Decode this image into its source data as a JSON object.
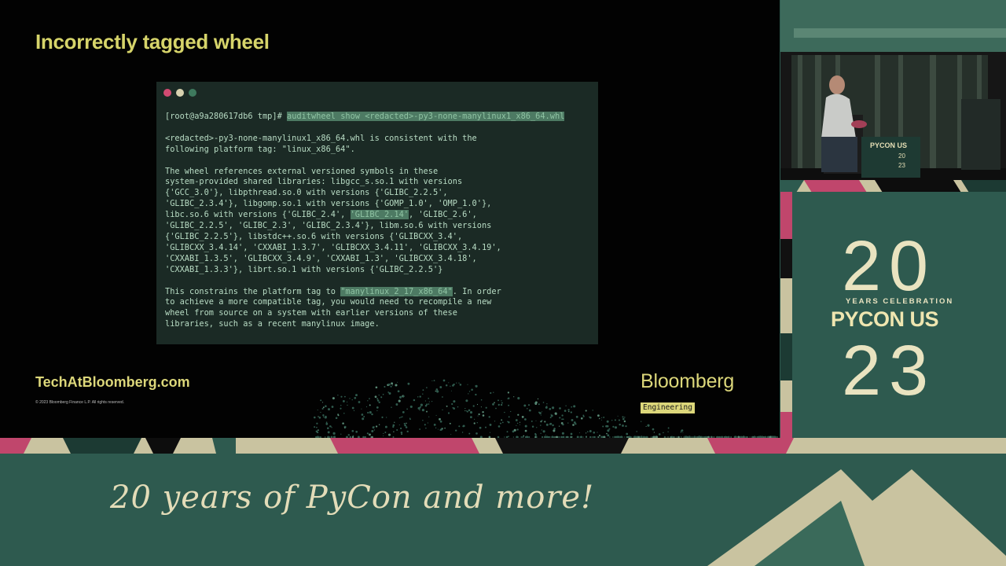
{
  "slide": {
    "title": "Incorrectly tagged wheel",
    "terminal": {
      "prompt": "[root@a9a280617db6 tmp]#",
      "command": "auditwheel show <redacted>-py3-none-manylinux1_x86_64.whl",
      "p1_a": "<redacted>-py3-none-manylinux1_x86_64.whl is consistent with the",
      "p1_b": "following platform tag: \"linux_x86_64\".",
      "p2_1": "The wheel references external versioned symbols in these",
      "p2_2": "system-provided shared libraries: libgcc_s.so.1 with versions",
      "p2_3": "{'GCC_3.0'}, libpthread.so.0 with versions {'GLIBC_2.2.5',",
      "p2_4": "'GLIBC_2.3.4'}, libgomp.so.1 with versions {'GOMP_1.0', 'OMP_1.0'},",
      "p2_5a": "libc.so.6 with versions {'GLIBC_2.4', ",
      "p2_5hl": "'GLIBC_2.14'",
      "p2_5b": ", 'GLIBC_2.6',",
      "p2_6": "'GLIBC_2.2.5', 'GLIBC_2.3', 'GLIBC_2.3.4'}, libm.so.6 with versions",
      "p2_7": "{'GLIBC_2.2.5'}, libstdc++.so.6 with versions {'GLIBCXX_3.4',",
      "p2_8": "'GLIBCXX_3.4.14', 'CXXABI_1.3.7', 'GLIBCXX_3.4.11', 'GLIBCXX_3.4.19',",
      "p2_9": "'CXXABI_1.3.5', 'GLIBCXX_3.4.9', 'CXXABI_1.3', 'GLIBCXX_3.4.18',",
      "p2_10": "'CXXABI_1.3.3'}, librt.so.1 with versions {'GLIBC_2.2.5'}",
      "p3_1a": "This constrains the platform tag to ",
      "p3_1hl": "\"manylinux_2_17_x86_64\"",
      "p3_1b": ". In order",
      "p3_2": "to achieve a more compatible tag, you would need to recompile a new",
      "p3_3": "wheel from source on a system with earlier versions of these",
      "p3_4": "libraries, such as a recent manylinux image."
    },
    "footer_url": "TechAtBloomberg.com",
    "footer_copyright": "© 2023 Bloomberg Finance L.P. All rights reserved.",
    "brand": "Bloomberg",
    "brand_sub": "Engineering"
  },
  "event": {
    "year_top": "20",
    "celebration": "YEARS CELEBRATION",
    "name": "PYCON US",
    "year_bottom": "23",
    "podium_name": "PYCON US",
    "podium_year_top": "20",
    "podium_year_bottom": "23",
    "tagline": "20 years of PyCon and more!"
  },
  "colors": {
    "slide_bg": "#020202",
    "title": "#d6d46a",
    "terminal_bg": "#1b2a25",
    "terminal_text": "#b8dcc4",
    "highlight": "#4d7a63",
    "frame_green": "#2e5a4f",
    "frame_cream": "#e9e3c0",
    "accent_pink": "#c0466c"
  }
}
